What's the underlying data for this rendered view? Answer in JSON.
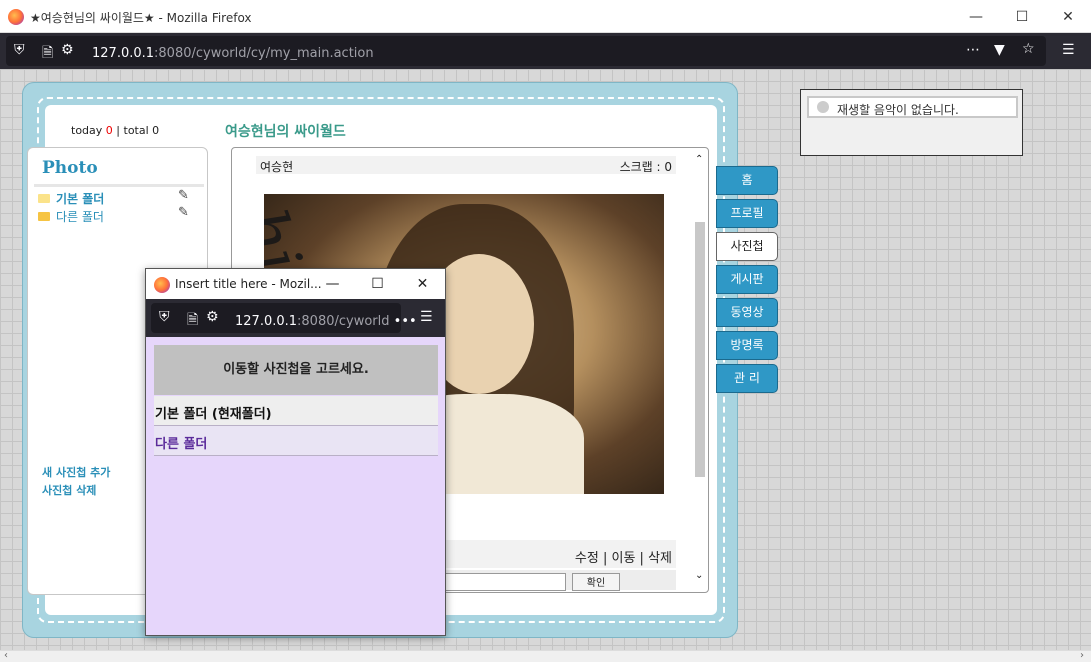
{
  "browser": {
    "window_title": "★여승현님의 싸이월드★ - Mozilla Firefox",
    "url_host": "127.0.0.1",
    "url_rest": ":8080/cyworld/cy/my_main.action",
    "icons": [
      "firefox-icon",
      "shield-icon",
      "page-icon",
      "permissions-icon",
      "more-icon",
      "pocket-icon",
      "star-icon",
      "menu-icon",
      "minimize-icon",
      "maximize-icon",
      "close-icon"
    ]
  },
  "counter": {
    "today_label": "today",
    "today": "0",
    "sep": "|",
    "total_label": "total",
    "total": "0"
  },
  "site_title": "여승현님의 싸이월드",
  "left": {
    "heading": "Photo",
    "folders": [
      {
        "label": "기본 폴더"
      },
      {
        "label": "다른 폴더"
      }
    ],
    "add_album": "새 사진첩 추가",
    "delete_album": "사진첩 삭제"
  },
  "post": {
    "author": "여승현",
    "scrap": "스크랩 : 0",
    "actions": {
      "edit": "수정",
      "move": "이동",
      "delete": "삭제",
      "sep": "|"
    },
    "confirm_button": "확인"
  },
  "tabs": [
    {
      "label": "홈"
    },
    {
      "label": "프로필"
    },
    {
      "label": "사진첩",
      "active": true
    },
    {
      "label": "게시판"
    },
    {
      "label": "동영상"
    },
    {
      "label": "방명록"
    },
    {
      "label": "관 리"
    }
  ],
  "music": {
    "status": "재생할 음악이 없습니다."
  },
  "popup": {
    "window_title": "Insert title here - Mozil...",
    "url_host": "127.0.0.1",
    "url_rest": ":8080/cyworld",
    "url_more": "•••",
    "header": "이동할 사진첩을 고르세요.",
    "options": [
      {
        "label": "기본 폴더 (현재폴더)"
      },
      {
        "label": "다른 폴더"
      }
    ]
  },
  "colors": {
    "accent": "#2a8fb8",
    "tab_bg": "#2f98c6",
    "frame": "#a8d4e0",
    "popup_bg": "#e6d6fb",
    "site_title": "#3a9a8a"
  }
}
